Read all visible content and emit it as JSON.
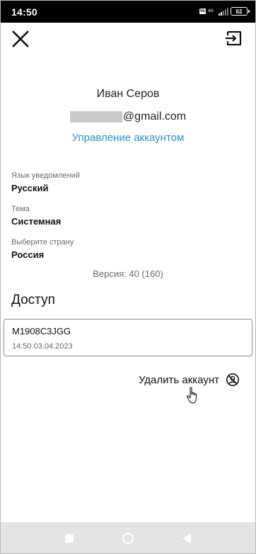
{
  "status_bar": {
    "time": "14:50",
    "vo_badge": "Vo",
    "network": "4G",
    "battery": "62"
  },
  "header": {
    "close_icon": "close-icon",
    "logout_icon": "logout-icon"
  },
  "profile": {
    "name": "Иван Серов",
    "email_suffix": "@gmail.com",
    "manage_link": "Управление аккаунтом"
  },
  "settings": [
    {
      "label": "Язык уведомлений",
      "value": "Русский"
    },
    {
      "label": "Тема",
      "value": "Системная"
    },
    {
      "label": "Выберите страну",
      "value": "Россия"
    }
  ],
  "version": "Версия: 40 (160)",
  "access": {
    "title": "Доступ",
    "devices": [
      {
        "id": "M1908C3JGG",
        "datetime": "14:50 03.04.2023"
      }
    ]
  },
  "delete_account": {
    "label": "Удалить аккаунт",
    "icon": "remove-account-icon"
  },
  "navigation": {
    "icons": [
      "recents-icon",
      "home-icon",
      "back-icon"
    ]
  },
  "colors": {
    "link": "#2e8fc4",
    "status_bar": "#000000",
    "nav_bar": "#e3e3e3"
  }
}
